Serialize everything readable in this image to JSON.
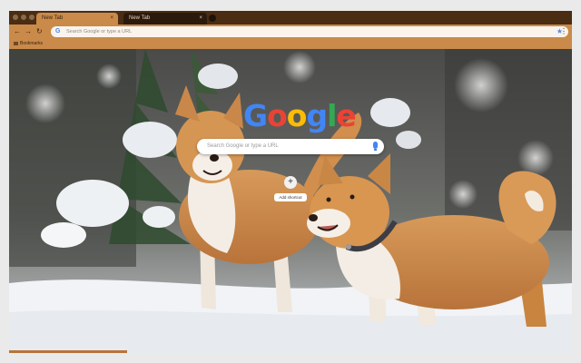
{
  "browser": {
    "tabs": [
      {
        "label": "New Tab",
        "close": "×"
      },
      {
        "label": "New Tab",
        "close": "×"
      }
    ],
    "omnibox": {
      "g_letter": "G",
      "placeholder": "Search Google or type a URL"
    },
    "bookmark": {
      "label": "Bookmarks"
    },
    "nav": {
      "back": "←",
      "forward": "→",
      "reload": "↻",
      "star": "★",
      "menu": "⋮"
    }
  },
  "newtab": {
    "logo_letters": [
      {
        "ch": "G",
        "color": "#4285F4"
      },
      {
        "ch": "o",
        "color": "#EA4335"
      },
      {
        "ch": "o",
        "color": "#FBBC05"
      },
      {
        "ch": "g",
        "color": "#4285F4"
      },
      {
        "ch": "l",
        "color": "#34A853"
      },
      {
        "ch": "e",
        "color": "#EA4335"
      }
    ],
    "search_placeholder": "Search Google or type a URL",
    "shortcut": {
      "icon": "+",
      "label": "Add shortcut"
    }
  },
  "theme": {
    "accent": "#C98A4A",
    "dark": "#4A2D12",
    "background_image": "two shiba inu dogs in snow"
  }
}
